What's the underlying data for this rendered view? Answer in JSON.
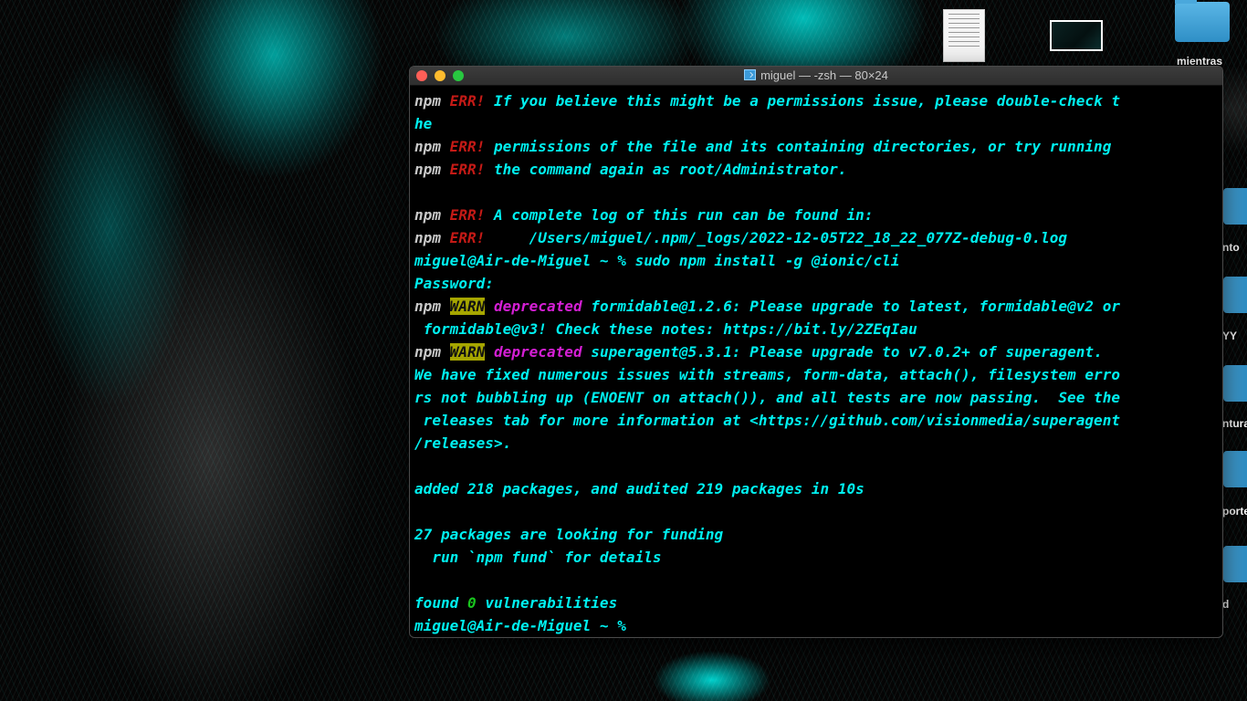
{
  "desktop": {
    "labels": [
      "mientras",
      "nto",
      "YY",
      "ntura",
      "porte",
      "d"
    ]
  },
  "window": {
    "title": "miguel — -zsh — 80×24"
  },
  "terminal": {
    "lines": [
      [
        {
          "t": "npm",
          "c": "npm"
        },
        {
          "t": " ",
          "c": ""
        },
        {
          "t": "ERR!",
          "c": "err"
        },
        {
          "t": " If you believe this might be a permissions issue, please double-check t",
          "c": ""
        }
      ],
      [
        {
          "t": "he",
          "c": ""
        }
      ],
      [
        {
          "t": "npm",
          "c": "npm"
        },
        {
          "t": " ",
          "c": ""
        },
        {
          "t": "ERR!",
          "c": "err"
        },
        {
          "t": " permissions of the file and its containing directories, or try running",
          "c": ""
        }
      ],
      [
        {
          "t": "npm",
          "c": "npm"
        },
        {
          "t": " ",
          "c": ""
        },
        {
          "t": "ERR!",
          "c": "err"
        },
        {
          "t": " the command again as root/Administrator.",
          "c": ""
        }
      ],
      [],
      [
        {
          "t": "npm",
          "c": "npm"
        },
        {
          "t": " ",
          "c": ""
        },
        {
          "t": "ERR!",
          "c": "err"
        },
        {
          "t": " A complete log of this run can be found in:",
          "c": ""
        }
      ],
      [
        {
          "t": "npm",
          "c": "npm"
        },
        {
          "t": " ",
          "c": ""
        },
        {
          "t": "ERR!",
          "c": "err"
        },
        {
          "t": "     /Users/miguel/.npm/_logs/2022-12-05T22_18_22_077Z-debug-0.log",
          "c": ""
        }
      ],
      [
        {
          "t": "miguel@Air-de-Miguel ~ % sudo npm install -g @ionic/cli",
          "c": ""
        }
      ],
      [
        {
          "t": "Password:",
          "c": ""
        }
      ],
      [
        {
          "t": "npm",
          "c": "npm"
        },
        {
          "t": " ",
          "c": ""
        },
        {
          "t": "WARN",
          "c": "warn"
        },
        {
          "t": " ",
          "c": ""
        },
        {
          "t": "deprecated",
          "c": "dep"
        },
        {
          "t": " formidable@1.2.6: Please upgrade to latest, formidable@v2 or",
          "c": ""
        }
      ],
      [
        {
          "t": " formidable@v3! Check these notes: https://bit.ly/2ZEqIau",
          "c": ""
        }
      ],
      [
        {
          "t": "npm",
          "c": "npm"
        },
        {
          "t": " ",
          "c": ""
        },
        {
          "t": "WARN",
          "c": "warn"
        },
        {
          "t": " ",
          "c": ""
        },
        {
          "t": "deprecated",
          "c": "dep"
        },
        {
          "t": " superagent@5.3.1: Please upgrade to v7.0.2+ of superagent.",
          "c": ""
        }
      ],
      [
        {
          "t": "We have fixed numerous issues with streams, form-data, attach(), filesystem erro",
          "c": ""
        }
      ],
      [
        {
          "t": "rs not bubbling up (ENOENT on attach()), and all tests are now passing.  See the",
          "c": ""
        }
      ],
      [
        {
          "t": " releases tab for more information at <https://github.com/visionmedia/superagent",
          "c": ""
        }
      ],
      [
        {
          "t": "/releases>.",
          "c": ""
        }
      ],
      [],
      [
        {
          "t": "added 218 packages, and audited 219 packages in 10s",
          "c": ""
        }
      ],
      [],
      [
        {
          "t": "27 packages are looking for funding",
          "c": ""
        }
      ],
      [
        {
          "t": "  run `npm fund` for details",
          "c": ""
        }
      ],
      [],
      [
        {
          "t": "found ",
          "c": ""
        },
        {
          "t": "0",
          "c": "zero"
        },
        {
          "t": " vulnerabilities",
          "c": ""
        }
      ],
      [
        {
          "t": "miguel@Air-de-Miguel ~ % ",
          "c": ""
        }
      ]
    ]
  }
}
